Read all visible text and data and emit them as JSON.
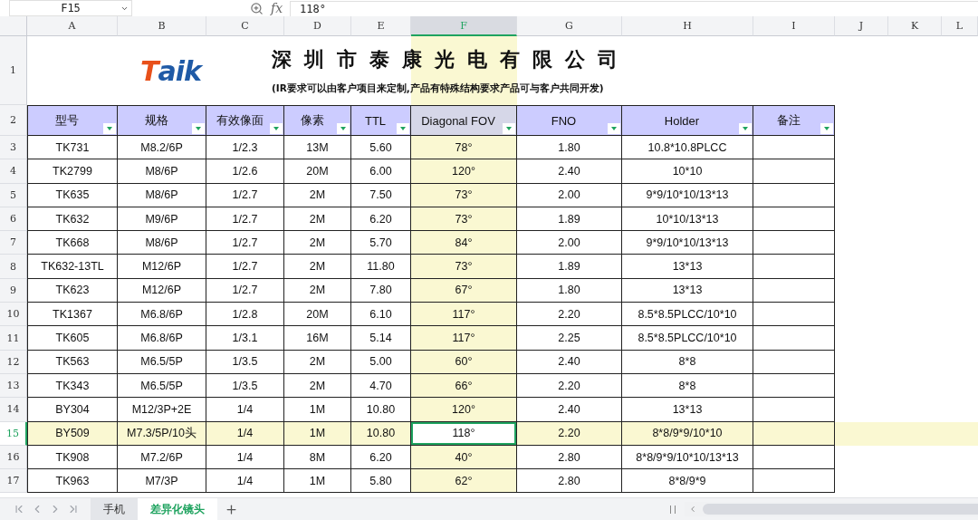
{
  "formula_bar": {
    "cell_ref": "F15",
    "fx_label": "fx",
    "value": "118°"
  },
  "columns": [
    {
      "label": "A",
      "selected": false
    },
    {
      "label": "B",
      "selected": false
    },
    {
      "label": "C",
      "selected": false
    },
    {
      "label": "D",
      "selected": false
    },
    {
      "label": "E",
      "selected": false
    },
    {
      "label": "F",
      "selected": true
    },
    {
      "label": "G",
      "selected": false
    },
    {
      "label": "H",
      "selected": false
    },
    {
      "label": "I",
      "selected": false
    },
    {
      "label": "J",
      "selected": false
    },
    {
      "label": "K",
      "selected": false
    },
    {
      "label": "L",
      "selected": false
    }
  ],
  "title_row": {
    "number": "1",
    "logo": "Taik",
    "title": "深圳市泰康光电有限公司",
    "subtitle": "(IR要求可以由客户项目来定制,产品有特殊结构要求产品可与客户共同开发)"
  },
  "header_row": {
    "number": "2",
    "headers": [
      "型号",
      "规格",
      "有效像面",
      "像素",
      "TTL",
      "Diagonal FOV",
      "FNO",
      "Holder",
      "备注"
    ]
  },
  "rows": [
    {
      "number": "3",
      "selected": false,
      "cells": [
        "TK731",
        "M8.2/6P",
        "1/2.3",
        "13M",
        "5.60",
        "78°",
        "1.80",
        "10.8*10.8PLCC"
      ]
    },
    {
      "number": "4",
      "selected": false,
      "cells": [
        "TK2799",
        "M8/6P",
        "1/2.6",
        "20M",
        "6.00",
        "120°",
        "2.40",
        "10*10"
      ]
    },
    {
      "number": "5",
      "selected": false,
      "cells": [
        "TK635",
        "M8/6P",
        "1/2.7",
        "2M",
        "7.50",
        "73°",
        "2.00",
        "9*9/10*10/13*13"
      ]
    },
    {
      "number": "6",
      "selected": false,
      "cells": [
        "TK632",
        "M9/6P",
        "1/2.7",
        "2M",
        "6.20",
        "73°",
        "1.89",
        "10*10/13*13"
      ]
    },
    {
      "number": "7",
      "selected": false,
      "cells": [
        "TK668",
        "M8/6P",
        "1/2.7",
        "2M",
        "5.70",
        "84°",
        "2.00",
        "9*9/10*10/13*13"
      ]
    },
    {
      "number": "8",
      "selected": false,
      "cells": [
        "TK632-13TL",
        "M12/6P",
        "1/2.7",
        "2M",
        "11.80",
        "73°",
        "1.89",
        "13*13"
      ]
    },
    {
      "number": "9",
      "selected": false,
      "cells": [
        "TK623",
        "M12/6P",
        "1/2.7",
        "2M",
        "7.80",
        "67°",
        "1.80",
        "13*13"
      ]
    },
    {
      "number": "10",
      "selected": false,
      "cells": [
        "TK1367",
        "M6.8/6P",
        "1/2.8",
        "20M",
        "6.10",
        "117°",
        "2.20",
        "8.5*8.5PLCC/10*10"
      ]
    },
    {
      "number": "11",
      "selected": false,
      "cells": [
        "TK605",
        "M6.8/6P",
        "1/3.1",
        "16M",
        "5.14",
        "117°",
        "2.25",
        "8.5*8.5PLCC/10*10"
      ]
    },
    {
      "number": "12",
      "selected": false,
      "cells": [
        "TK563",
        "M6.5/5P",
        "1/3.5",
        "2M",
        "5.00",
        "60°",
        "2.40",
        "8*8"
      ]
    },
    {
      "number": "13",
      "selected": false,
      "cells": [
        "TK343",
        "M6.5/5P",
        "1/3.5",
        "2M",
        "4.70",
        "66°",
        "2.20",
        "8*8"
      ]
    },
    {
      "number": "14",
      "selected": false,
      "cells": [
        "BY304",
        "M12/3P+2E",
        "1/4",
        "1M",
        "10.80",
        "120°",
        "2.40",
        "13*13"
      ]
    },
    {
      "number": "15",
      "selected": true,
      "cells": [
        "BY509",
        "M7.3/5P/10头",
        "1/4",
        "1M",
        "10.80",
        "118°",
        "2.20",
        "8*8/9*9/10*10"
      ]
    },
    {
      "number": "16",
      "selected": false,
      "cells": [
        "TK908",
        "M7.2/6P",
        "1/4",
        "8M",
        "6.20",
        "40°",
        "2.80",
        "8*8/9*9/10*10/13*13"
      ]
    },
    {
      "number": "17",
      "selected": false,
      "cells": [
        "TK963",
        "M7/3P",
        "1/4",
        "1M",
        "5.80",
        "62°",
        "2.80",
        "8*8/9*9"
      ]
    }
  ],
  "sheet_tabs": [
    {
      "label": "手机",
      "selected": false
    },
    {
      "label": "差异化镜头",
      "selected": true
    }
  ]
}
